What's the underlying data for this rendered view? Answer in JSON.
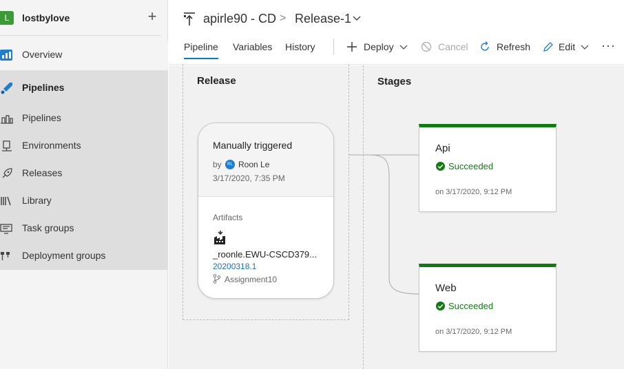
{
  "org": {
    "initial": "L",
    "name": "lostbylove",
    "add": "+"
  },
  "nav": {
    "overview": "Overview",
    "pipelines_group": "Pipelines",
    "items": [
      "Pipelines",
      "Environments",
      "Releases",
      "Library",
      "Task groups",
      "Deployment groups"
    ]
  },
  "breadcrumb": {
    "project": "apirle90 - CD",
    "separator": ">",
    "release": "Release-1"
  },
  "tabs": [
    "Pipeline",
    "Variables",
    "History"
  ],
  "toolbar": {
    "deploy": "Deploy",
    "cancel": "Cancel",
    "refresh": "Refresh",
    "edit": "Edit",
    "more": "···"
  },
  "canvas": {
    "release_title": "Release",
    "stages_title": "Stages",
    "release_card": {
      "trigger": "Manually triggered",
      "by": "by",
      "avatar_initials": "RL",
      "user": "Roon Le",
      "date": "3/17/2020, 7:35 PM",
      "artifacts_label": "Artifacts",
      "artifact_name": "_roonle.EWU-CSCD379...",
      "artifact_build": "20200318.1",
      "artifact_branch": "Assignment10"
    },
    "stages": [
      {
        "name": "Api",
        "status": "Succeeded",
        "date": "on 3/17/2020, 9:12 PM"
      },
      {
        "name": "Web",
        "status": "Succeeded",
        "date": "on 3/17/2020, 9:12 PM"
      }
    ]
  },
  "colors": {
    "accent": "#0078d4",
    "success": "#107c10",
    "org": "#3d9b35"
  }
}
